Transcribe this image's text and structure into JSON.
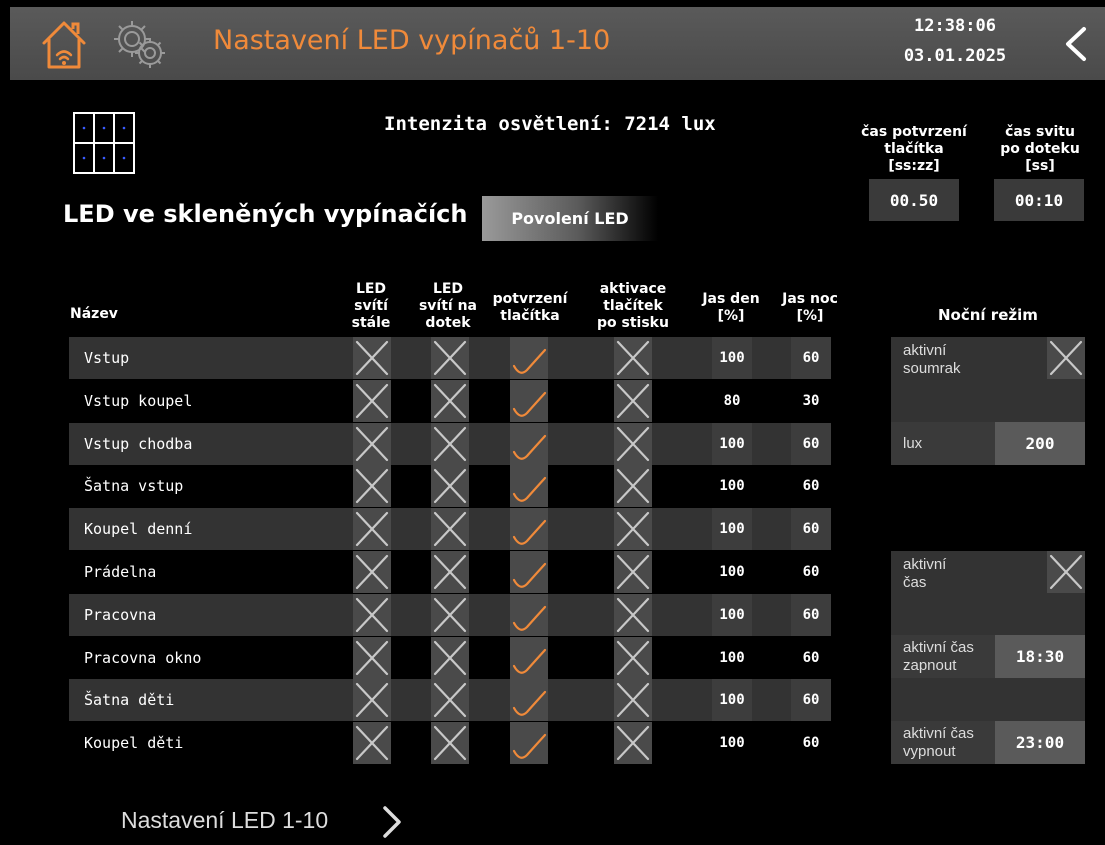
{
  "header": {
    "title": "Nastavení LED vypínačů 1-10",
    "time": "12:38:06",
    "date": "03.01.2025",
    "accent_color": "#f08a3a"
  },
  "intensity": "Intenzita osvětlení: 7214 lux",
  "confirm_time": {
    "label_line1": "čas potvrzení",
    "label_line2": "tlačítka",
    "label_line3": "[ss:zz]",
    "value": "00.50"
  },
  "glow_time": {
    "label_line1": "čas svitu",
    "label_line2": "po doteku",
    "label_line3": "[ss]",
    "value": "00:10"
  },
  "section_title": "LED ve skleněných vypínačích",
  "enable_button": "Povolení LED",
  "columns": {
    "name": "Název",
    "always_on": [
      "LED",
      "svítí",
      "stále"
    ],
    "on_touch": [
      "LED",
      "svítí na",
      "dotek"
    ],
    "confirm": [
      "potvrzení",
      "tlačítka"
    ],
    "activation": [
      "aktivace",
      "tlačítek",
      "po stisku"
    ],
    "day": [
      "Jas den",
      "[%]"
    ],
    "night": [
      "Jas noc",
      "[%]"
    ]
  },
  "rows": [
    {
      "name": "Vstup",
      "day": "100",
      "night": "60",
      "always_on": false,
      "on_touch": false,
      "confirm": true,
      "activation": false
    },
    {
      "name": "Vstup koupel",
      "day": "80",
      "night": "30",
      "always_on": false,
      "on_touch": false,
      "confirm": true,
      "activation": false
    },
    {
      "name": "Vstup chodba",
      "day": "100",
      "night": "60",
      "always_on": false,
      "on_touch": false,
      "confirm": true,
      "activation": false
    },
    {
      "name": "Šatna vstup",
      "day": "100",
      "night": "60",
      "always_on": false,
      "on_touch": false,
      "confirm": true,
      "activation": false
    },
    {
      "name": "Koupel denní",
      "day": "100",
      "night": "60",
      "always_on": false,
      "on_touch": false,
      "confirm": true,
      "activation": false
    },
    {
      "name": "Prádelna",
      "day": "100",
      "night": "60",
      "always_on": false,
      "on_touch": false,
      "confirm": true,
      "activation": false
    },
    {
      "name": "Pracovna",
      "day": "100",
      "night": "60",
      "always_on": false,
      "on_touch": false,
      "confirm": true,
      "activation": false
    },
    {
      "name": "Pracovna okno",
      "day": "100",
      "night": "60",
      "always_on": false,
      "on_touch": false,
      "confirm": true,
      "activation": false
    },
    {
      "name": "Šatna děti",
      "day": "100",
      "night": "60",
      "always_on": false,
      "on_touch": false,
      "confirm": true,
      "activation": false
    },
    {
      "name": "Koupel děti",
      "day": "100",
      "night": "60",
      "always_on": false,
      "on_touch": false,
      "confirm": true,
      "activation": false
    }
  ],
  "night_mode": {
    "title": "Noční režim",
    "dusk_label_1": "aktivní",
    "dusk_label_2": "soumrak",
    "lux_label": "lux",
    "lux_value": "200",
    "time_label_1": "aktivní",
    "time_label_2": "čas",
    "on_label_1": "aktivní čas",
    "on_label_2": "zapnout",
    "on_value": "18:30",
    "off_label_1": "aktivní čas",
    "off_label_2": "vypnout",
    "off_value": "23:00"
  },
  "footer_link": "Nastavení LED 1-10"
}
